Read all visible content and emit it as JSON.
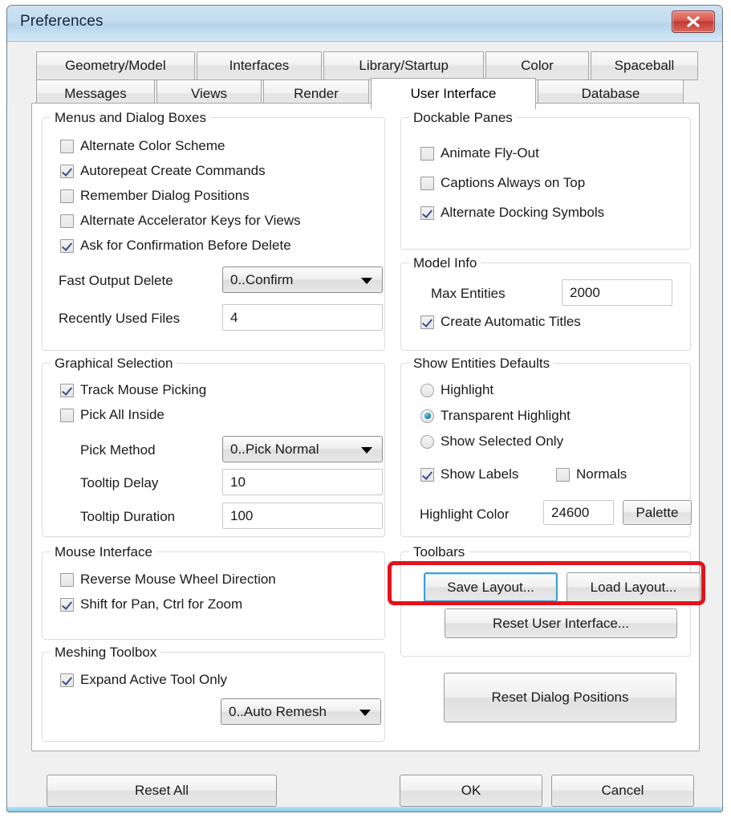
{
  "window": {
    "title": "Preferences",
    "close_icon": "close-icon",
    "close_glyph": "X"
  },
  "tabs": {
    "row1": [
      {
        "label": "Geometry/Model",
        "selected": false
      },
      {
        "label": "Interfaces",
        "selected": false
      },
      {
        "label": "Library/Startup",
        "selected": false
      },
      {
        "label": "Color",
        "selected": false
      },
      {
        "label": "Spaceball",
        "selected": false
      }
    ],
    "row2": [
      {
        "label": "Messages",
        "selected": false
      },
      {
        "label": "Views",
        "selected": false
      },
      {
        "label": "Render",
        "selected": false
      },
      {
        "label": "User Interface",
        "selected": true
      },
      {
        "label": "Database",
        "selected": false
      }
    ]
  },
  "groups": {
    "menus_dialog_boxes": {
      "legend": "Menus and Dialog Boxes",
      "checkboxes": [
        {
          "label": "Alternate Color Scheme",
          "checked": false
        },
        {
          "label": "Autorepeat Create Commands",
          "checked": true
        },
        {
          "label": "Remember Dialog Positions",
          "checked": false
        },
        {
          "label": "Alternate Accelerator Keys for Views",
          "checked": false
        },
        {
          "label": "Ask for Confirmation Before Delete",
          "checked": true
        }
      ],
      "fast_output_delete": {
        "label": "Fast Output Delete",
        "value": "0..Confirm"
      },
      "recently_used_files": {
        "label": "Recently Used Files",
        "value": "4"
      }
    },
    "graphical_selection": {
      "legend": "Graphical Selection",
      "checkboxes": [
        {
          "label": "Track Mouse Picking",
          "checked": true
        },
        {
          "label": "Pick All Inside",
          "checked": false
        }
      ],
      "pick_method": {
        "label": "Pick Method",
        "value": "0..Pick Normal"
      },
      "tooltip_delay": {
        "label": "Tooltip Delay",
        "value": "10"
      },
      "tooltip_duration": {
        "label": "Tooltip Duration",
        "value": "100"
      }
    },
    "mouse_interface": {
      "legend": "Mouse Interface",
      "checkboxes": [
        {
          "label": "Reverse Mouse Wheel Direction",
          "checked": false
        },
        {
          "label": "Shift for Pan, Ctrl for Zoom",
          "checked": true
        }
      ]
    },
    "meshing_toolbox": {
      "legend": "Meshing Toolbox",
      "checkboxes": [
        {
          "label": "Expand Active Tool Only",
          "checked": true
        }
      ],
      "remesh_mode": {
        "value": "0..Auto Remesh"
      }
    },
    "dockable_panes": {
      "legend": "Dockable Panes",
      "checkboxes": [
        {
          "label": "Animate Fly-Out",
          "checked": false
        },
        {
          "label": "Captions Always on Top",
          "checked": false
        },
        {
          "label": "Alternate Docking Symbols",
          "checked": true
        }
      ]
    },
    "model_info": {
      "legend": "Model Info",
      "max_entities": {
        "label": "Max Entities",
        "value": "2000"
      },
      "checkboxes": [
        {
          "label": "Create Automatic Titles",
          "checked": true
        }
      ]
    },
    "show_entities_defaults": {
      "legend": "Show Entities Defaults",
      "radios": [
        {
          "label": "Highlight",
          "selected": false
        },
        {
          "label": "Transparent Highlight",
          "selected": true
        },
        {
          "label": "Show Selected Only",
          "selected": false
        }
      ],
      "show_labels": {
        "label": "Show Labels",
        "checked": true
      },
      "normals": {
        "label": "Normals",
        "checked": false
      },
      "highlight_color": {
        "label": "Highlight Color",
        "value": "24600",
        "button": "Palette"
      }
    },
    "toolbars": {
      "legend": "Toolbars",
      "save_layout": "Save Layout...",
      "load_layout": "Load Layout...",
      "reset_user_interface": "Reset User Interface..."
    }
  },
  "reset_dialog_positions": "Reset Dialog Positions",
  "footer": {
    "reset_all": "Reset All",
    "ok": "OK",
    "cancel": "Cancel"
  },
  "colors": {
    "annotation": "#e3121c",
    "focus_ring": "#3f9fd4",
    "titlebar": "#c3dcf0",
    "close_button": "#c03a32"
  }
}
